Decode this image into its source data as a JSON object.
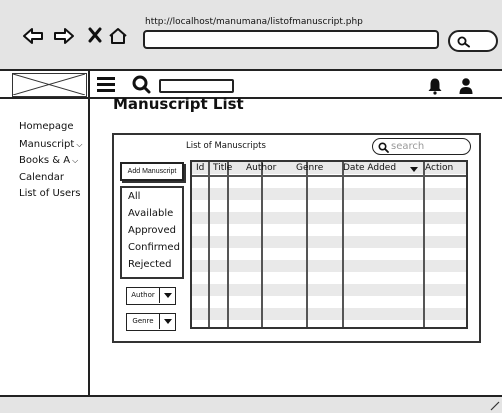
{
  "browser": {
    "url": "http://localhost/manumana/listofmanuscript.php",
    "address_value": ""
  },
  "sidebar": {
    "items": [
      {
        "label": "Homepage",
        "has_chevron": false
      },
      {
        "label": "Manuscript",
        "has_chevron": true
      },
      {
        "label": "Books & A",
        "has_chevron": true
      },
      {
        "label": "Calendar",
        "has_chevron": false
      },
      {
        "label": "List of Users",
        "has_chevron": false
      }
    ],
    "chevron": "⌵"
  },
  "main": {
    "page_title": "Manuscript List",
    "panel_title": "List of Manuscripts",
    "search_placeholder": "search",
    "add_button": "Add Manuscript",
    "filters": [
      "All",
      "Available",
      "Approved",
      "Confirmed",
      "Rejected"
    ],
    "dropdowns": [
      {
        "label": "Author"
      },
      {
        "label": "Genre"
      }
    ],
    "table": {
      "columns": [
        "Id",
        "Title",
        "Author",
        "Genre",
        "Date Added",
        "Action"
      ],
      "rows": []
    }
  },
  "icons": {
    "back": "arrow-left-icon",
    "forward": "arrow-right-icon",
    "close": "x-icon",
    "home": "home-icon",
    "menu": "hamburger-icon",
    "search": "search-icon",
    "notifications": "bell-icon",
    "profile": "user-icon"
  }
}
